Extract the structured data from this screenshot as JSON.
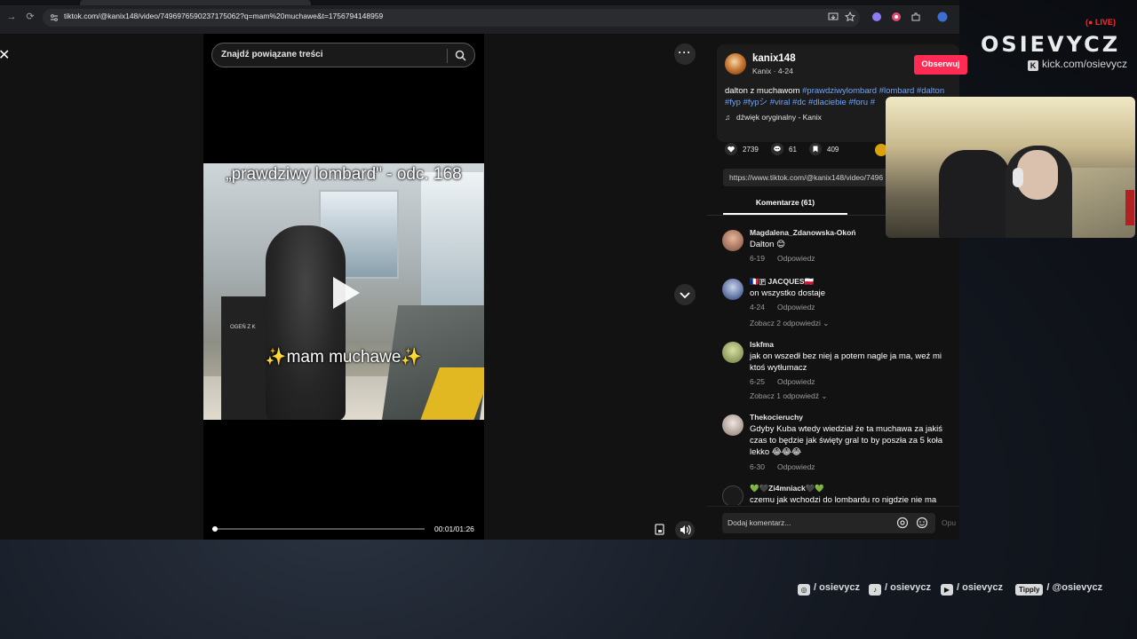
{
  "browser": {
    "url": "tiktok.com/@kanix148/video/7496976590237175062?q=mam%20muchawe&t=1756794148959"
  },
  "search": {
    "placeholder": "Znajdź powiązane treści"
  },
  "video": {
    "overlay_title": "„prawdziwy lombard\" - odc. 168",
    "overlay_caption": "✨mam muchawe✨",
    "signage_text": "OGEŃ Z K",
    "time": "00:01/01:26",
    "progress": 0.012
  },
  "author": {
    "name": "kanix148",
    "sub": "Kanix · 4-24",
    "follow_label": "Obserwuj",
    "description_plain": "dalton z muchawom ",
    "description_tags": "#prawdziwylombard #lombard #dalton #fyp #fypシ #viral #dc #dlaciebie #foru #",
    "music": "dźwięk oryginalny - Kanix"
  },
  "actions": {
    "likes": "2739",
    "comments": "61",
    "saves": "409"
  },
  "link": "https://www.tiktok.com/@kanix148/video/7496",
  "tabs": {
    "comments": "Komentarze (61)"
  },
  "comments": [
    {
      "user": "Magdalena_Zdanowska-Okoń",
      "text": "Dalton 😊",
      "date": "6-19",
      "reply": "Odpowiedz"
    },
    {
      "user": "🇨🇵🇵 JACQUES🇵🇱",
      "text": "on wszystko dostaje",
      "date": "4-24",
      "reply": "Odpowiedz",
      "more": "Zobacz 2 odpowiedzi ⌄"
    },
    {
      "user": "Iskfma",
      "text": "jak on wszedł bez niej a potem nagle ja ma, weź mi ktoś wytłumacz",
      "date": "6-25",
      "reply": "Odpowiedz",
      "more": "Zobacz 1 odpowiedź ⌄"
    },
    {
      "user": "Thekocieruchy",
      "text": "Gdyby Kuba wtedy wiedział że ta muchawa za jakiś czas to będzie jak święty gral to by poszła za 5 koła lekko 😂😂😂",
      "date": "6-30",
      "reply": "Odpowiedz"
    },
    {
      "user": "💚🖤Zi4mniack🖤💚",
      "text": "czemu jak wchodzi do lombardu ro nigdzie nie ma"
    }
  ],
  "add_comment": {
    "placeholder": "Dodaj komentarz...",
    "post": "Opu"
  },
  "overlay": {
    "live": "(● LIVE)",
    "brand": "OSIEVYCZ",
    "kick": "kick.com/osievycz",
    "socials": {
      "instagram": "/ osievycz",
      "tiktok": "/ osievycz",
      "youtube": "/ osievycz",
      "tipply_label": "Tipply",
      "tipply": "/ @osievycz"
    }
  },
  "colors": {
    "accent": "#fe2c55",
    "hashtag": "#6ca5ff",
    "live": "#ff2a2a"
  }
}
